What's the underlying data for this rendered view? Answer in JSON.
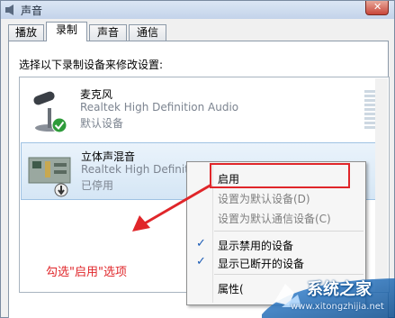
{
  "window": {
    "title": "声音"
  },
  "tabs": [
    {
      "label": "播放"
    },
    {
      "label": "录制",
      "active": true
    },
    {
      "label": "声音"
    },
    {
      "label": "通信"
    }
  ],
  "instruction": "选择以下录制设备来修改设置:",
  "devices": [
    {
      "name": "麦克风",
      "driver": "Realtek High Definition Audio",
      "status": "默认设备",
      "icon": "microphone-icon",
      "badge": "green-check-icon"
    },
    {
      "name": "立体声混音",
      "driver": "Realtek High Definition",
      "status": "已停用",
      "icon": "sound-card-icon",
      "badge": "disabled-arrow-icon",
      "selected": true
    }
  ],
  "context_menu": {
    "items": [
      {
        "label": "启用",
        "disabled": false,
        "checked": false
      },
      {
        "label": "设置为默认设备(D)",
        "disabled": true,
        "checked": false
      },
      {
        "label": "设置为默认通信设备(C)",
        "disabled": true,
        "checked": false
      },
      {
        "label": "显示禁用的设备",
        "disabled": false,
        "checked": true
      },
      {
        "label": "显示已断开的设备",
        "disabled": false,
        "checked": true
      },
      {
        "label": "属性(",
        "disabled": false,
        "checked": false
      }
    ]
  },
  "annotation": "勾选\"启用\"选项",
  "watermark": {
    "name": "系统之家",
    "url": "www.xitongzhijia.net"
  },
  "colors": {
    "annotation": "#e0262a",
    "highlight": "#e0262a",
    "check": "#1a5bb5"
  }
}
